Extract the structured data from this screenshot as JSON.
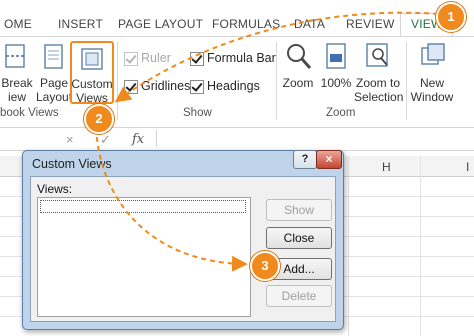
{
  "ribbon": {
    "tabs": [
      "OME",
      "INSERT",
      "PAGE LAYOUT",
      "FORMULAS",
      "DATA",
      "REVIEW",
      "VIEW"
    ],
    "active_tab": "VIEW",
    "workbook_views": {
      "break_preview": [
        "Break",
        "iew"
      ],
      "page_layout": [
        "Page",
        "Layout"
      ],
      "custom_views": [
        "Custom",
        "Views"
      ],
      "group_label": "book Views"
    },
    "show": {
      "ruler": "Ruler",
      "formula_bar": "Formula Bar",
      "gridlines": "Gridlines",
      "headings": "Headings",
      "group_label": "Show"
    },
    "zoom": {
      "zoom": "Zoom",
      "hundred": "100%",
      "zoom_to_selection": [
        "Zoom to",
        "Selection"
      ],
      "group_label": "Zoom"
    },
    "window": {
      "new_window": [
        "New",
        "Window"
      ]
    }
  },
  "formula_bar": {
    "cancel": "×",
    "enter": "✓",
    "fx": "fx"
  },
  "grid": {
    "columns": [
      "H",
      "I"
    ]
  },
  "dialog": {
    "title": "Custom Views",
    "help": "?",
    "close": "×",
    "views_label": "Views:",
    "buttons": {
      "show": "Show",
      "close": "Close",
      "add": "Add...",
      "delete": "Delete"
    }
  },
  "callouts": [
    "1",
    "2",
    "3"
  ],
  "colors": {
    "accent_green": "#217346",
    "callout_orange": "#f08a1c",
    "dialog_frame": "#bfd4ea"
  }
}
